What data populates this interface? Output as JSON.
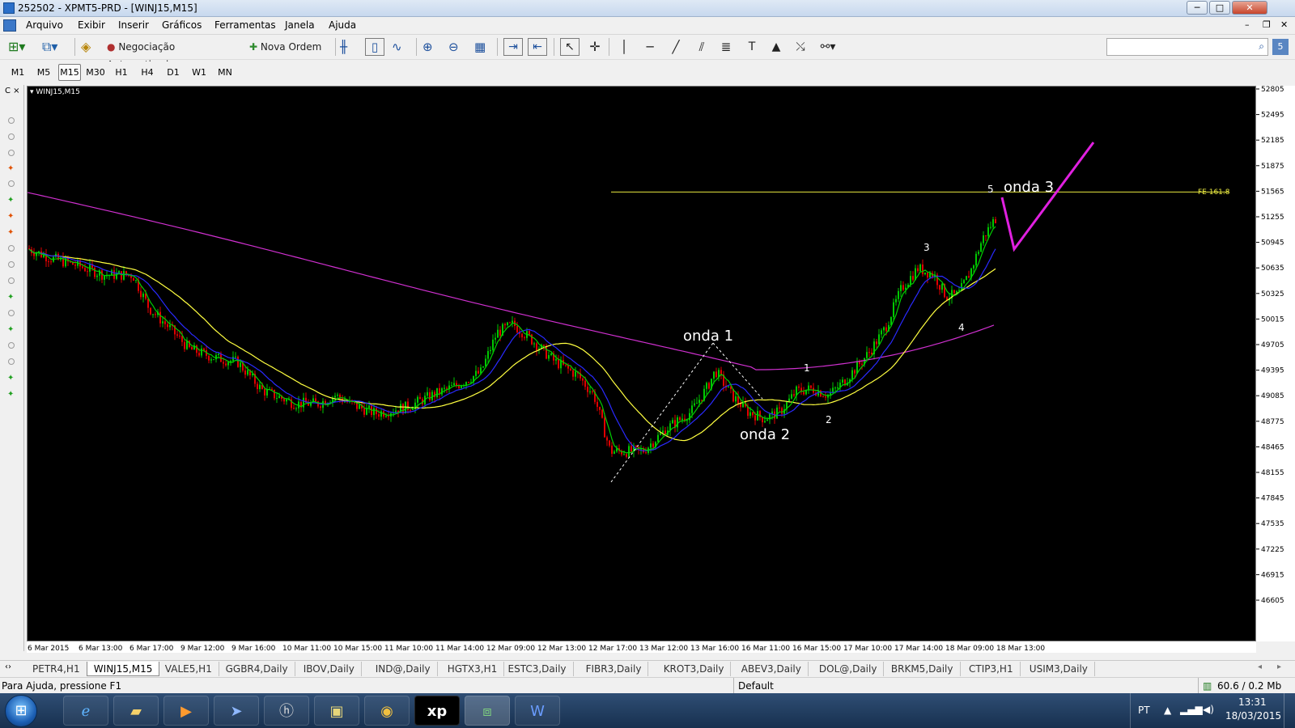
{
  "window": {
    "title": "252502 - XPMT5-PRD - [WINJ15,M15]",
    "min": "─",
    "max": "□",
    "close": "✕"
  },
  "menu": [
    "Arquivo",
    "Exibir",
    "Inserir",
    "Gráficos",
    "Ferramentas",
    "Janela",
    "Ajuda"
  ],
  "toolbar": {
    "auto_trading": "Negociação Automatizada",
    "new_order": "Nova Ordem"
  },
  "timeframes": [
    "M1",
    "M5",
    "M15",
    "M30",
    "H1",
    "H4",
    "D1",
    "W1",
    "MN"
  ],
  "selected_timeframe": "M15",
  "chart": {
    "symbol_label": "WINJ15,M15",
    "price_labels": [
      "52805",
      "52495",
      "52185",
      "51875",
      "51565",
      "51255",
      "50945",
      "50635",
      "50325",
      "50015",
      "49705",
      "49395",
      "49085",
      "48775",
      "48465",
      "48155",
      "47845",
      "47535",
      "47225",
      "46915",
      "46605"
    ],
    "time_labels": [
      "6 Mar 2015",
      "6 Mar 13:00",
      "6 Mar 17:00",
      "9 Mar 12:00",
      "9 Mar 16:00",
      "10 Mar 11:00",
      "10 Mar 15:00",
      "11 Mar 10:00",
      "11 Mar 14:00",
      "12 Mar 09:00",
      "12 Mar 13:00",
      "12 Mar 17:00",
      "13 Mar 12:00",
      "13 Mar 16:00",
      "16 Mar 11:00",
      "16 Mar 15:00",
      "17 Mar 10:00",
      "17 Mar 14:00",
      "18 Mar 09:00",
      "18 Mar 13:00"
    ],
    "fibo_label": "FE 161.8",
    "fibo_price": 51565,
    "annotations": [
      "onda 1",
      "onda 2",
      "onda 3"
    ],
    "wave_counts": [
      "1",
      "2",
      "3",
      "4",
      "5"
    ],
    "colors": {
      "bull": "#00c800",
      "bear": "#e00000",
      "ma_fast": "#00d000",
      "ma_mid": "#2a2aff",
      "ma_slow": "#ffff40",
      "ma_long": "#d030d0",
      "fibo": "#e8e840",
      "arrow": "#e020e0"
    }
  },
  "tabs": [
    "PETR4,H1",
    "WINJ15,M15",
    "VALE5,H1",
    "GGBR4,Daily",
    "IBOV,Daily",
    "IND@,Daily",
    "HGTX3,H1",
    "ESTC3,Daily",
    "FIBR3,Daily",
    "KROT3,Daily",
    "ABEV3,Daily",
    "DOL@,Daily",
    "BRKM5,Daily",
    "CTIP3,H1",
    "USIM3,Daily"
  ],
  "active_tab": "WINJ15,M15",
  "status": {
    "help": "Para Ajuda, pressione F1",
    "profile": "Default",
    "traffic": "60.6 / 0.2 Mb"
  },
  "taskbar": {
    "lang": "PT",
    "time": "13:31",
    "date": "18/03/2015",
    "xp_label": "xp"
  }
}
